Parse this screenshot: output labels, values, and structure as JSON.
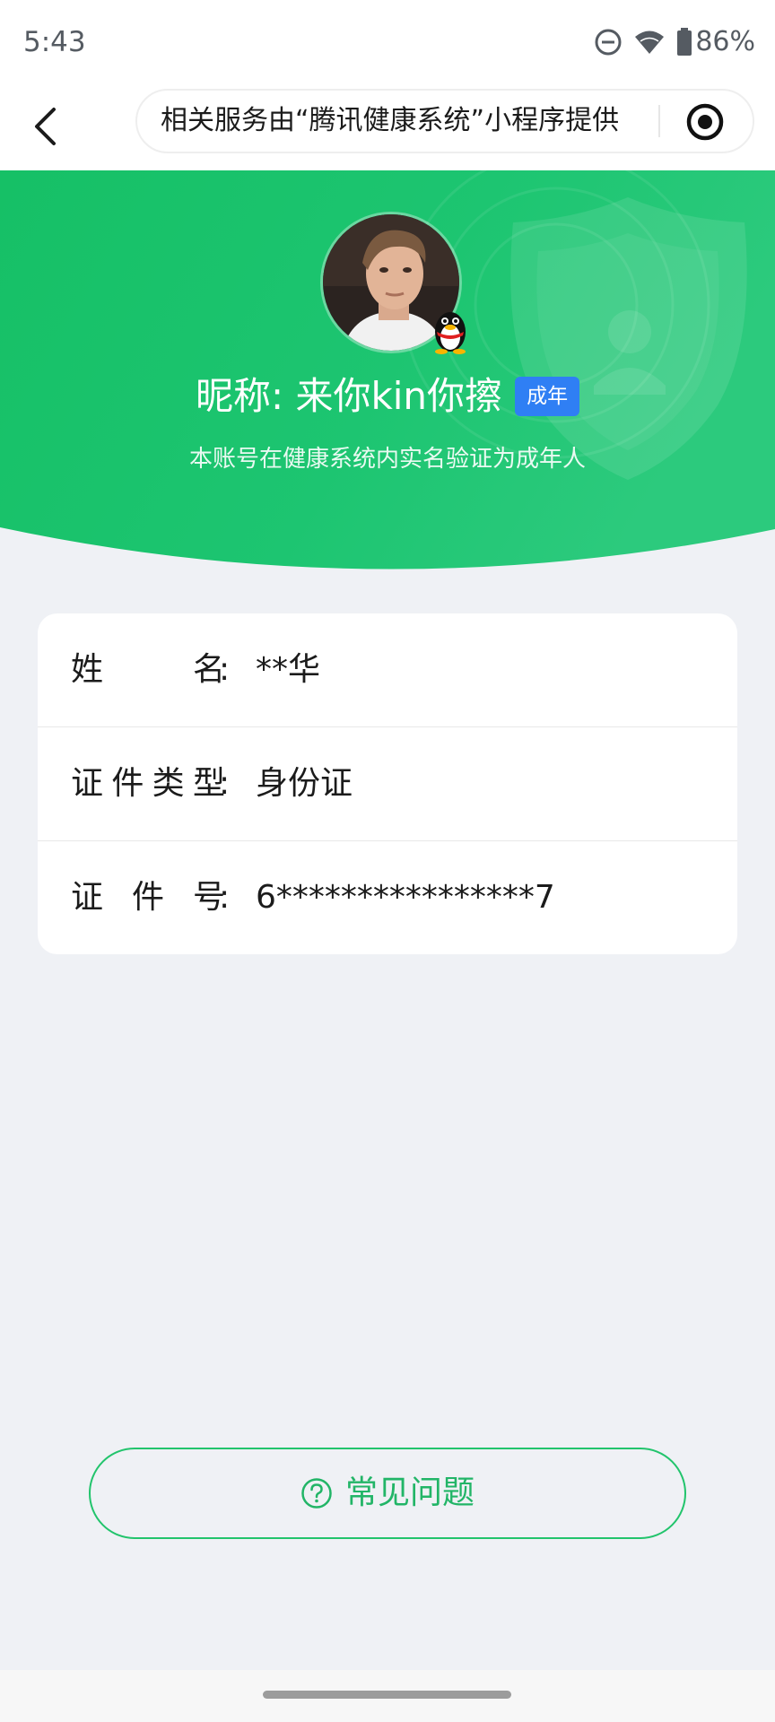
{
  "status_bar": {
    "time": "5:43",
    "battery_percent": "86%",
    "icons": [
      "do-not-disturb-icon",
      "wifi-icon",
      "battery-icon"
    ]
  },
  "nav": {
    "back_icon": "chevron-left-icon",
    "service_text": "相关服务由“腾讯健康系统”小程序提供",
    "action_icon": "target-icon"
  },
  "profile": {
    "nickname": "昵称: 来你kin你擦",
    "age_badge": "成年",
    "subtitle": "本账号在健康系统内实名验证为成年人",
    "badge_icon": "qq-penguin-icon",
    "colors": {
      "header_green": "#1dc571",
      "badge_blue": "#2f7ff4"
    }
  },
  "identity": {
    "rows": [
      {
        "label": "姓名",
        "value": "**华"
      },
      {
        "label": "证件类型",
        "value": "身份证"
      },
      {
        "label": "证件号",
        "value": "6****************7"
      }
    ],
    "colon": ":"
  },
  "faq": {
    "label": "常见问题",
    "icon": "question-circle-icon",
    "color": "#22b567"
  }
}
